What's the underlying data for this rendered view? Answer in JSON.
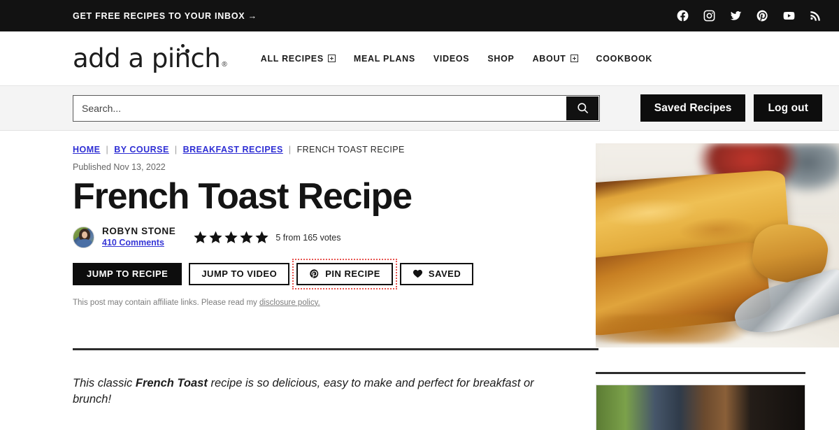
{
  "topbar": {
    "cta": "GET FREE RECIPES TO YOUR INBOX →",
    "socials": [
      {
        "name": "facebook-icon"
      },
      {
        "name": "instagram-icon"
      },
      {
        "name": "twitter-icon"
      },
      {
        "name": "pinterest-icon"
      },
      {
        "name": "youtube-icon"
      },
      {
        "name": "rss-icon"
      }
    ],
    "bg_color": "#121212"
  },
  "header": {
    "logo_text": "add a pinch",
    "logo_registered": "®",
    "nav": [
      {
        "label": "ALL RECIPES",
        "has_plus": true
      },
      {
        "label": "MEAL PLANS",
        "has_plus": false
      },
      {
        "label": "VIDEOS",
        "has_plus": false
      },
      {
        "label": "SHOP",
        "has_plus": false
      },
      {
        "label": "ABOUT",
        "has_plus": true
      },
      {
        "label": "COOKBOOK",
        "has_plus": false
      }
    ]
  },
  "search": {
    "placeholder": "Search...",
    "value": "",
    "icon": "search-icon",
    "saved_recipes_label": "Saved Recipes",
    "logout_label": "Log out"
  },
  "breadcrumb": {
    "items": [
      {
        "label": "HOME",
        "link": true
      },
      {
        "label": "BY COURSE",
        "link": true
      },
      {
        "label": "BREAKFAST RECIPES",
        "link": true
      },
      {
        "label": "FRENCH TOAST RECIPE",
        "link": false
      }
    ],
    "separator": "|"
  },
  "article": {
    "published": "Published Nov 13, 2022",
    "title": "French Toast Recipe",
    "author_name": "ROBYN STONE",
    "comments_label": "410 Comments",
    "rating_stars": 5,
    "rating_text": "5 from 165 votes",
    "affiliate_text": "This post may contain affiliate links. Please read my ",
    "affiliate_link": "disclosure policy.",
    "intro_before": "This classic ",
    "intro_bold": "French Toast",
    "intro_after": " recipe is so delicious, easy to make and perfect for breakfast or brunch!"
  },
  "actions": [
    {
      "label": "JUMP TO RECIPE",
      "style": "filled",
      "icon": null,
      "focused": false
    },
    {
      "label": "JUMP TO VIDEO",
      "style": "outline",
      "icon": null,
      "focused": false
    },
    {
      "label": "PIN RECIPE",
      "style": "outline",
      "icon": "pinterest-icon",
      "focused": true
    },
    {
      "label": "SAVED",
      "style": "outline",
      "icon": "heart-icon",
      "focused": false
    }
  ],
  "media": {
    "hero_alt": "french-toast-hero-image",
    "sidebar_alt": "sidebar-thumbnail-image"
  },
  "colors": {
    "accent_link": "#2f2fd4",
    "focus_outline": "#e8544f",
    "dark": "#0d0d0d",
    "search_row_bg": "#f4f4f4"
  }
}
